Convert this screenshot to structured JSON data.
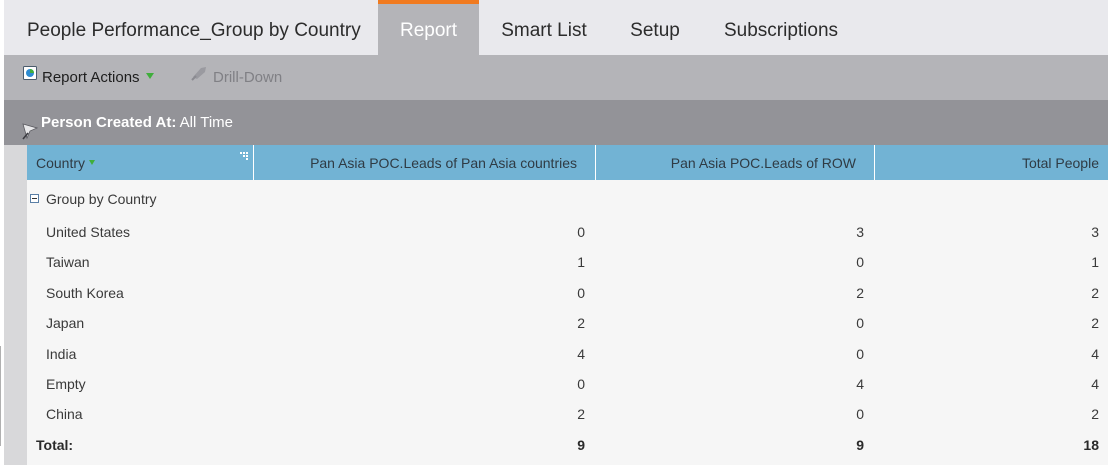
{
  "tabs": {
    "title": "People Performance_Group by Country",
    "items": [
      "Report",
      "Smart List",
      "Setup",
      "Subscriptions"
    ]
  },
  "toolbar": {
    "report_actions": "Report Actions",
    "drill_down": "Drill-Down"
  },
  "filter": {
    "label": "Person Created At:",
    "value": "All Time"
  },
  "table": {
    "columns": [
      "Country",
      "Pan Asia POC.Leads of Pan Asia countries",
      "Pan Asia POC.Leads of ROW",
      "Total People"
    ],
    "group_label": "Group by Country",
    "rows": [
      {
        "name": "United States",
        "v1": "0",
        "v2": "3",
        "v3": "3"
      },
      {
        "name": "Taiwan",
        "v1": "1",
        "v2": "0",
        "v3": "1"
      },
      {
        "name": "South Korea",
        "v1": "0",
        "v2": "2",
        "v3": "2"
      },
      {
        "name": "Japan",
        "v1": "2",
        "v2": "0",
        "v3": "2"
      },
      {
        "name": "India",
        "v1": "4",
        "v2": "0",
        "v3": "4"
      },
      {
        "name": "Empty",
        "v1": "0",
        "v2": "4",
        "v3": "4"
      },
      {
        "name": "China",
        "v1": "2",
        "v2": "0",
        "v3": "2"
      }
    ],
    "total": {
      "name": "Total:",
      "v1": "9",
      "v2": "9",
      "v3": "18"
    }
  },
  "colors": {
    "active_tab_accent": "#f07a1f",
    "header_blue": "#72b3d4",
    "sort_arrow_green": "#3fae3b"
  },
  "icons": [
    "report-actions-icon",
    "dropdown-arrow-icon",
    "drill-down-icon",
    "filter-icon",
    "sort-arrow-icon",
    "collapse-group-icon"
  ]
}
